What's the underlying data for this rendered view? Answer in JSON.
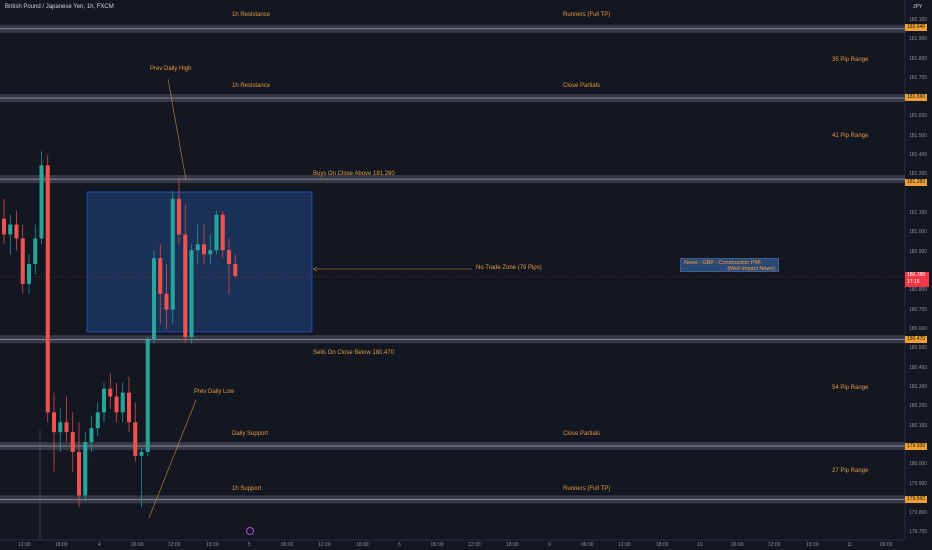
{
  "header": {
    "symbol_title": "British Pound / Japanese Yen, 1h, FXCM",
    "currency": "JPY"
  },
  "colors": {
    "background": "#131722",
    "bull": "#26a69a",
    "bear": "#ef5350",
    "level_fill": "#434651",
    "annotation_orange": "#e59a3e",
    "zone_fill": "#1e3a66",
    "zone_border": "#2962ff"
  },
  "y_axis": {
    "min": 179.5,
    "max": 182.1,
    "ticks": [
      "182.100",
      "181.900",
      "181.800",
      "181.700",
      "181.600",
      "181.500",
      "181.400",
      "181.300",
      "181.100",
      "181.000",
      "180.900",
      "180.800",
      "180.700",
      "180.600",
      "180.500",
      "180.400",
      "180.300",
      "180.200",
      "180.100",
      "180.000",
      "179.900",
      "179.800",
      "179.700",
      "179.600",
      "179.500"
    ],
    "tags": [
      "182.040",
      "181.690",
      "181.280",
      "180.470",
      "179.930",
      "179.660"
    ],
    "current_price": "180.788",
    "countdown": "17:16"
  },
  "x_axis": {
    "ticks": [
      "12:00",
      "18:00",
      "4",
      "06:00",
      "12:00",
      "18:00",
      "5",
      "06:00",
      "12:00",
      "18:00",
      "6",
      "06:00",
      "12:00",
      "18:00",
      "9",
      "06:00",
      "12:00",
      "18:00",
      "10",
      "06:00",
      "12:00",
      "18:00",
      "11",
      "06:00"
    ]
  },
  "levels": [
    {
      "price": 182.04,
      "left_label": "1h Resistance",
      "right_label": "Runners (Full TP)"
    },
    {
      "price": 181.69,
      "left_label": "1h Resistance",
      "right_label": "Close Partials"
    },
    {
      "price": 181.28,
      "left_label": "Buys On Close Above 181.280",
      "right_label": ""
    },
    {
      "price": 180.47,
      "left_label": "Sells On Close Below 180.470",
      "right_label": ""
    },
    {
      "price": 179.93,
      "left_label": "Daily Support",
      "right_label": "Close Partials"
    },
    {
      "price": 179.66,
      "left_label": "1h Support",
      "right_label": "Runners (Full TP)"
    }
  ],
  "pip_ranges": [
    "35 Pip Range",
    "41 Pip Range",
    "54 Pip Range",
    "27 Pip Range"
  ],
  "annotations": {
    "prev_daily_high": "Prev Daily High",
    "prev_daily_low": "Prev Daily Low",
    "no_trade_zone": "No Trade Zone (79 Pips)"
  },
  "news": {
    "line1": "News : GBP : Construction PMI",
    "line2": "(Med Impact News)"
  },
  "chart_data": {
    "type": "candlestick",
    "title": "British Pound / Japanese Yen, 1h, FXCM",
    "ylim": [
      179.5,
      182.1
    ],
    "candles": [
      {
        "o": 181.08,
        "h": 181.18,
        "l": 180.95,
        "c": 181.0
      },
      {
        "o": 181.0,
        "h": 181.1,
        "l": 180.9,
        "c": 181.05
      },
      {
        "o": 181.05,
        "h": 181.12,
        "l": 180.92,
        "c": 180.98
      },
      {
        "o": 180.98,
        "h": 181.05,
        "l": 180.7,
        "c": 180.75
      },
      {
        "o": 180.75,
        "h": 180.9,
        "l": 180.7,
        "c": 180.85
      },
      {
        "o": 180.85,
        "h": 181.05,
        "l": 180.8,
        "c": 180.98
      },
      {
        "o": 180.98,
        "h": 181.42,
        "l": 180.95,
        "c": 181.35
      },
      {
        "o": 181.35,
        "h": 181.4,
        "l": 180.05,
        "c": 180.1
      },
      {
        "o": 180.1,
        "h": 180.2,
        "l": 179.8,
        "c": 180.0
      },
      {
        "o": 180.0,
        "h": 180.12,
        "l": 179.9,
        "c": 180.05
      },
      {
        "o": 180.05,
        "h": 180.18,
        "l": 179.95,
        "c": 180.0
      },
      {
        "o": 180.0,
        "h": 180.1,
        "l": 179.8,
        "c": 179.9
      },
      {
        "o": 179.9,
        "h": 180.05,
        "l": 179.62,
        "c": 179.68
      },
      {
        "o": 179.68,
        "h": 180.0,
        "l": 179.65,
        "c": 179.95
      },
      {
        "o": 179.95,
        "h": 180.08,
        "l": 179.9,
        "c": 180.02
      },
      {
        "o": 180.02,
        "h": 180.15,
        "l": 179.98,
        "c": 180.1
      },
      {
        "o": 180.1,
        "h": 180.25,
        "l": 180.05,
        "c": 180.22
      },
      {
        "o": 180.22,
        "h": 180.3,
        "l": 180.12,
        "c": 180.18
      },
      {
        "o": 180.18,
        "h": 180.25,
        "l": 180.05,
        "c": 180.1
      },
      {
        "o": 180.1,
        "h": 180.25,
        "l": 180.05,
        "c": 180.2
      },
      {
        "o": 180.2,
        "h": 180.28,
        "l": 180.0,
        "c": 180.05
      },
      {
        "o": 180.05,
        "h": 180.15,
        "l": 179.85,
        "c": 179.88
      },
      {
        "o": 179.88,
        "h": 179.92,
        "l": 179.62,
        "c": 179.9
      },
      {
        "o": 179.9,
        "h": 180.48,
        "l": 179.88,
        "c": 180.47
      },
      {
        "o": 180.47,
        "h": 180.92,
        "l": 180.45,
        "c": 180.88
      },
      {
        "o": 180.88,
        "h": 180.95,
        "l": 180.55,
        "c": 180.7
      },
      {
        "o": 180.7,
        "h": 180.85,
        "l": 180.52,
        "c": 180.62
      },
      {
        "o": 180.62,
        "h": 181.22,
        "l": 180.55,
        "c": 181.18
      },
      {
        "o": 181.18,
        "h": 181.28,
        "l": 180.95,
        "c": 181.0
      },
      {
        "o": 181.0,
        "h": 181.15,
        "l": 180.45,
        "c": 180.48
      },
      {
        "o": 180.48,
        "h": 180.95,
        "l": 180.45,
        "c": 180.92
      },
      {
        "o": 180.92,
        "h": 181.05,
        "l": 180.85,
        "c": 180.95
      },
      {
        "o": 180.95,
        "h": 181.05,
        "l": 180.85,
        "c": 180.9
      },
      {
        "o": 180.9,
        "h": 181.0,
        "l": 180.85,
        "c": 180.92
      },
      {
        "o": 180.92,
        "h": 181.12,
        "l": 180.9,
        "c": 181.1
      },
      {
        "o": 181.1,
        "h": 181.12,
        "l": 180.88,
        "c": 180.92
      },
      {
        "o": 180.92,
        "h": 180.98,
        "l": 180.7,
        "c": 180.85
      },
      {
        "o": 180.85,
        "h": 180.9,
        "l": 180.78,
        "c": 180.79
      }
    ]
  }
}
